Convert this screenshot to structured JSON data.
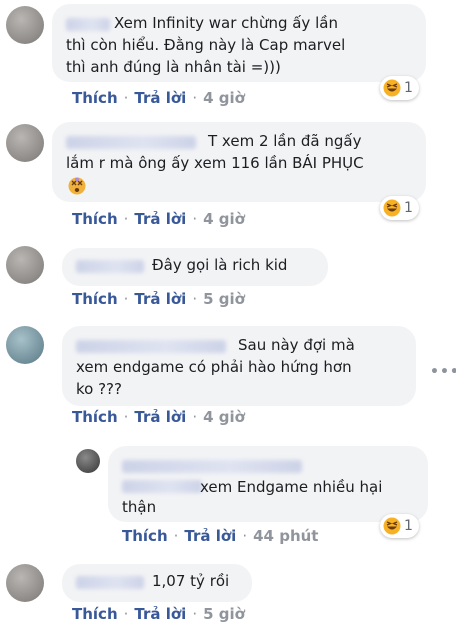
{
  "actions": {
    "like": "Thích",
    "reply": "Trả lời",
    "separator": "·"
  },
  "comments": [
    {
      "lines": [
        "Xem Infinity war chừng ấy lần",
        "thì còn hiểu. Đằng này là Cap marvel",
        "thì anh đúng là nhân tài =)))"
      ],
      "time": "4 giờ",
      "reactions": {
        "icon": "haha-icon",
        "count": "1"
      }
    },
    {
      "lines": [
        "T xem 2 lần đã ngấy",
        "lắm r mà ông ấy xem 116 lần BÁI PHỤC"
      ],
      "trailing_emoji": "dizzy-face-emoji",
      "time": "4 giờ",
      "reactions": {
        "icon": "haha-icon",
        "count": "1"
      }
    },
    {
      "lines": [
        "Đây gọi là rich kid"
      ],
      "time": "5 giờ"
    },
    {
      "lines": [
        "Sau này đợi mà",
        "xem endgame có phải hào hứng hơn",
        "ko ???"
      ],
      "time": "4 giờ",
      "more_icon": "more-options-icon"
    },
    {
      "lines": [
        "xem Endgame nhiều hại",
        "thận"
      ],
      "time": "44 phút",
      "reactions": {
        "icon": "haha-icon",
        "count": "1"
      }
    },
    {
      "lines": [
        "1,07 tỷ rồi"
      ],
      "time": "5 giờ"
    }
  ],
  "colors": {
    "link": "#385898",
    "bubble": "#f2f3f5",
    "meta": "#90949c",
    "haha": "#f7b125"
  }
}
